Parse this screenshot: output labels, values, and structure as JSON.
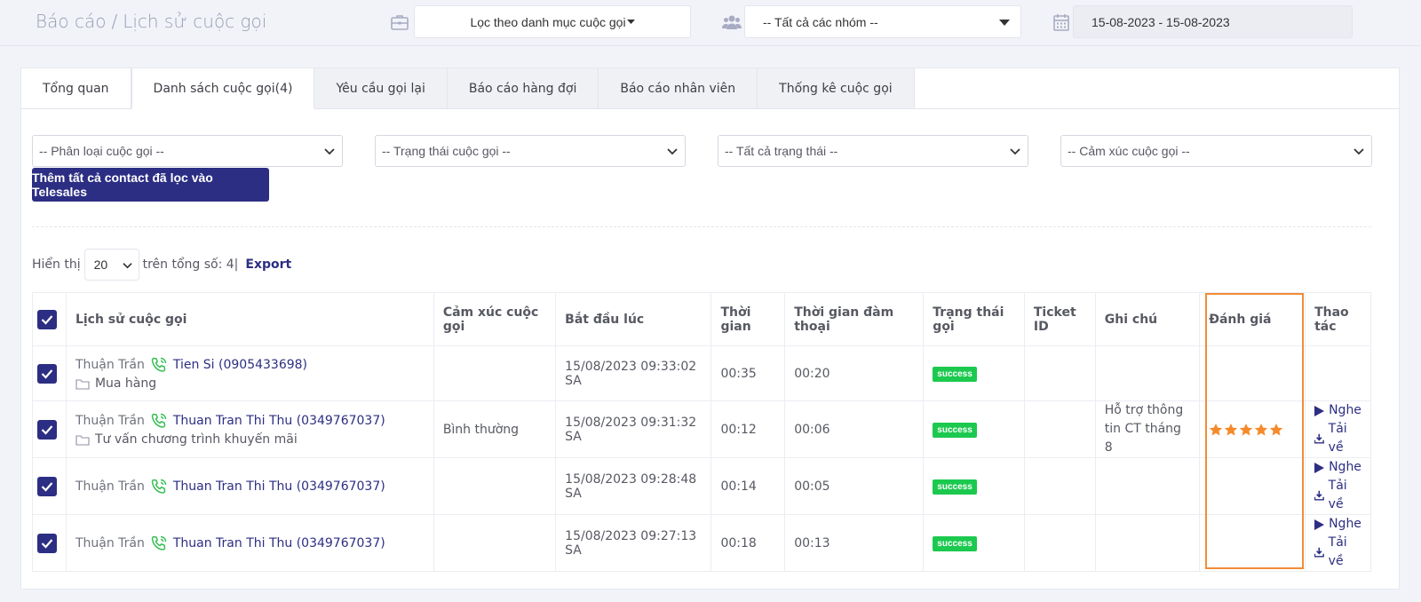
{
  "header": {
    "breadcrumb_root": "Báo cáo",
    "breadcrumb_sep": "/",
    "breadcrumb_current": "Lịch sử cuộc gọi",
    "category_filter": "Lọc theo danh mục cuộc gọi",
    "group_filter": "-- Tất cả các nhóm --",
    "date_range": "15-08-2023 - 15-08-2023"
  },
  "tabs": [
    {
      "label": "Tổng quan"
    },
    {
      "label": "Danh sách cuộc gọi(4)"
    },
    {
      "label": "Yêu cầu gọi lại"
    },
    {
      "label": "Báo cáo hàng đợi"
    },
    {
      "label": "Báo cáo nhân viên"
    },
    {
      "label": "Thống kê cuộc gọi"
    }
  ],
  "active_tab": "Danh sách cuộc gọi(4)",
  "filters": {
    "call_type": "-- Phân loại cuộc gọi --",
    "call_status": "-- Trạng thái cuộc gọi --",
    "all_status": "-- Tất cả trạng thái --",
    "emotion": "-- Cảm xúc cuộc gọi --",
    "add_button": "Thêm tất cả contact đã lọc vào Telesales"
  },
  "paging": {
    "show_label": "Hiển thị",
    "page_size": "20",
    "total_label": "trên tổng số: 4|",
    "export_label": "Export"
  },
  "table": {
    "columns": [
      "Lịch sử cuộc gọi",
      "Cảm xúc cuộc gọi",
      "Bắt đầu lúc",
      "Thời gian",
      "Thời gian đàm thoại",
      "Trạng thái gọi",
      "Ticket ID",
      "Ghi chú",
      "Đánh giá",
      "Thao tác"
    ],
    "rows": [
      {
        "caller": "Thuận Trần",
        "callee": "Tien Si (0905433698)",
        "category": "Mua hàng",
        "emotion": "",
        "start": "15/08/2023 09:33:02 SA",
        "duration": "00:35",
        "talk_time": "00:20",
        "status": "success",
        "ticket": "",
        "note_1": "",
        "note_2": "",
        "rating": 0,
        "listen": "",
        "download": ""
      },
      {
        "caller": "Thuận Trần",
        "callee": "Thuan Tran Thi Thu (0349767037)",
        "category": "Tư vấn chương trình khuyến mãi",
        "emotion": "Bình thường",
        "start": "15/08/2023 09:31:32 SA",
        "duration": "00:12",
        "talk_time": "00:06",
        "status": "success",
        "ticket": "",
        "note_1": "Hỗ trợ thông",
        "note_2": "tin CT tháng 8",
        "rating": 5,
        "listen": "Nghe",
        "download": "Tải về"
      },
      {
        "caller": "Thuận Trần",
        "callee": "Thuan Tran Thi Thu (0349767037)",
        "category": "",
        "emotion": "",
        "start": "15/08/2023 09:28:48 SA",
        "duration": "00:14",
        "talk_time": "00:05",
        "status": "success",
        "ticket": "",
        "note_1": "",
        "note_2": "",
        "rating": 0,
        "listen": "Nghe",
        "download": "Tải về"
      },
      {
        "caller": "Thuận Trần",
        "callee": "Thuan Tran Thi Thu (0349767037)",
        "category": "",
        "emotion": "",
        "start": "15/08/2023 09:27:13 SA",
        "duration": "00:18",
        "talk_time": "00:13",
        "status": "success",
        "ticket": "",
        "note_1": "",
        "note_2": "",
        "rating": 0,
        "listen": "Nghe",
        "download": "Tải về"
      }
    ]
  },
  "colors": {
    "primary": "#2c2e83",
    "success": "#1cc94f",
    "star": "#f58a2b",
    "highlight": "#f28c38",
    "phone": "#34bf52"
  }
}
